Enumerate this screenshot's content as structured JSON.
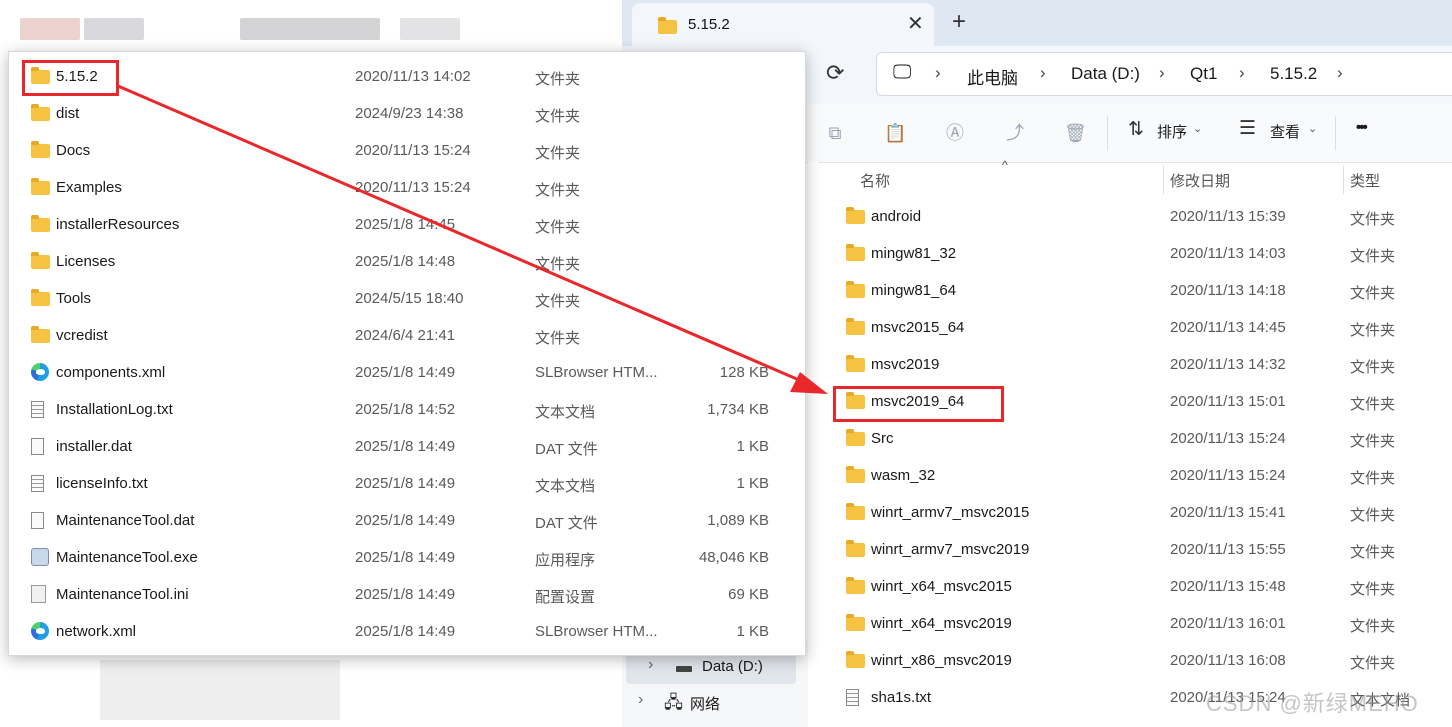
{
  "tab": {
    "title": "5.15.2",
    "close": "✕",
    "new": "+"
  },
  "breadcrumb": [
    "此电脑",
    "Data (D:)",
    "Qt1",
    "5.15.2"
  ],
  "toolbar": {
    "sort_label": "排序",
    "view_label": "查看",
    "more_label": "•••"
  },
  "columns": {
    "name": "名称",
    "date": "修改日期",
    "type": "类型"
  },
  "right_files": [
    {
      "name": "android",
      "date": "2020/11/13 15:39",
      "type": "文件夹"
    },
    {
      "name": "mingw81_32",
      "date": "2020/11/13 14:03",
      "type": "文件夹"
    },
    {
      "name": "mingw81_64",
      "date": "2020/11/13 14:18",
      "type": "文件夹"
    },
    {
      "name": "msvc2015_64",
      "date": "2020/11/13 14:45",
      "type": "文件夹"
    },
    {
      "name": "msvc2019",
      "date": "2020/11/13 14:32",
      "type": "文件夹"
    },
    {
      "name": "msvc2019_64",
      "date": "2020/11/13 15:01",
      "type": "文件夹"
    },
    {
      "name": "Src",
      "date": "2020/11/13 15:24",
      "type": "文件夹"
    },
    {
      "name": "wasm_32",
      "date": "2020/11/13 15:24",
      "type": "文件夹"
    },
    {
      "name": "winrt_armv7_msvc2015",
      "date": "2020/11/13 15:41",
      "type": "文件夹"
    },
    {
      "name": "winrt_armv7_msvc2019",
      "date": "2020/11/13 15:55",
      "type": "文件夹"
    },
    {
      "name": "winrt_x64_msvc2015",
      "date": "2020/11/13 15:48",
      "type": "文件夹"
    },
    {
      "name": "winrt_x64_msvc2019",
      "date": "2020/11/13 16:01",
      "type": "文件夹"
    },
    {
      "name": "winrt_x86_msvc2019",
      "date": "2020/11/13 16:08",
      "type": "文件夹"
    },
    {
      "name": "sha1s.txt",
      "date": "2020/11/13 15:24",
      "type": "文本文档"
    }
  ],
  "nav": {
    "drive": "Data (D:)",
    "network": "网络"
  },
  "left_files": [
    {
      "name": "5.15.2",
      "date": "2020/11/13 14:02",
      "type": "文件夹",
      "size": "",
      "icon": "folder"
    },
    {
      "name": "dist",
      "date": "2024/9/23 14:38",
      "type": "文件夹",
      "size": "",
      "icon": "folder"
    },
    {
      "name": "Docs",
      "date": "2020/11/13 15:24",
      "type": "文件夹",
      "size": "",
      "icon": "folder"
    },
    {
      "name": "Examples",
      "date": "2020/11/13 15:24",
      "type": "文件夹",
      "size": "",
      "icon": "folder"
    },
    {
      "name": "installerResources",
      "date": "2025/1/8 14:45",
      "type": "文件夹",
      "size": "",
      "icon": "folder"
    },
    {
      "name": "Licenses",
      "date": "2025/1/8 14:48",
      "type": "文件夹",
      "size": "",
      "icon": "folder"
    },
    {
      "name": "Tools",
      "date": "2024/5/15 18:40",
      "type": "文件夹",
      "size": "",
      "icon": "folder"
    },
    {
      "name": "vcredist",
      "date": "2024/6/4 21:41",
      "type": "文件夹",
      "size": "",
      "icon": "folder"
    },
    {
      "name": "components.xml",
      "date": "2025/1/8 14:49",
      "type": "SLBrowser HTM...",
      "size": "128 KB",
      "icon": "edge"
    },
    {
      "name": "InstallationLog.txt",
      "date": "2025/1/8 14:52",
      "type": "文本文档",
      "size": "1,734 KB",
      "icon": "text"
    },
    {
      "name": "installer.dat",
      "date": "2025/1/8 14:49",
      "type": "DAT 文件",
      "size": "1 KB",
      "icon": "doc"
    },
    {
      "name": "licenseInfo.txt",
      "date": "2025/1/8 14:49",
      "type": "文本文档",
      "size": "1 KB",
      "icon": "text"
    },
    {
      "name": "MaintenanceTool.dat",
      "date": "2025/1/8 14:49",
      "type": "DAT 文件",
      "size": "1,089 KB",
      "icon": "doc"
    },
    {
      "name": "MaintenanceTool.exe",
      "date": "2025/1/8 14:49",
      "type": "应用程序",
      "size": "48,046 KB",
      "icon": "exe"
    },
    {
      "name": "MaintenanceTool.ini",
      "date": "2025/1/8 14:49",
      "type": "配置设置",
      "size": "69 KB",
      "icon": "ini"
    },
    {
      "name": "network.xml",
      "date": "2025/1/8 14:49",
      "type": "SLBrowser HTM...",
      "size": "1 KB",
      "icon": "edge"
    }
  ],
  "watermark": "CSDN @新绿MEHO",
  "colors": {
    "highlight": "#e8282b",
    "folder": "#f5c242"
  }
}
